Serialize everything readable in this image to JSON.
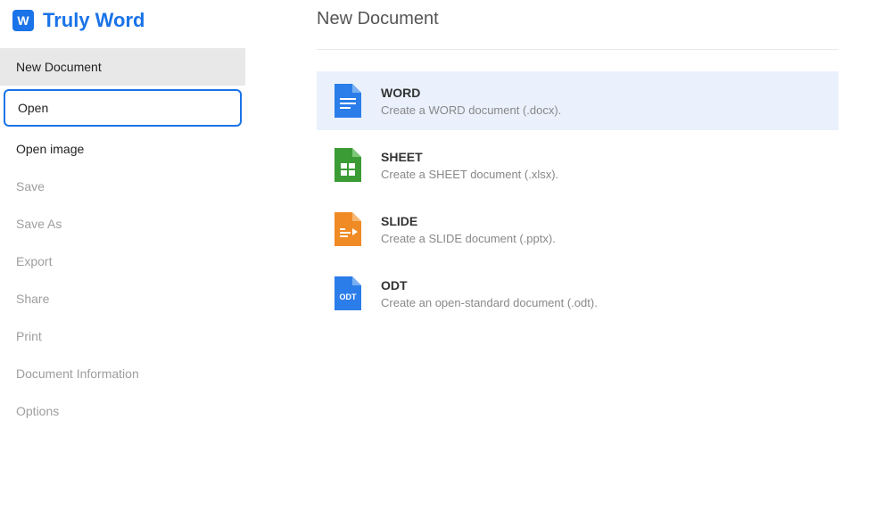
{
  "brand": {
    "title": "Truly Word",
    "icon_glyph": "W"
  },
  "sidebar": {
    "items": [
      {
        "label": "New Document",
        "state": "active"
      },
      {
        "label": "Open",
        "state": "highlighted"
      },
      {
        "label": "Open image",
        "state": "enabled"
      },
      {
        "label": "Save",
        "state": "disabled"
      },
      {
        "label": "Save As",
        "state": "disabled"
      },
      {
        "label": "Export",
        "state": "disabled"
      },
      {
        "label": "Share",
        "state": "disabled"
      },
      {
        "label": "Print",
        "state": "disabled"
      },
      {
        "label": "Document Information",
        "state": "disabled"
      },
      {
        "label": "Options",
        "state": "disabled"
      }
    ]
  },
  "main": {
    "title": "New Document",
    "options": [
      {
        "kind": "word",
        "title": "WORD",
        "desc": "Create a WORD document (.docx).",
        "selected": true,
        "icon_color": "#2b7de9"
      },
      {
        "kind": "sheet",
        "title": "SHEET",
        "desc": "Create a SHEET document (.xlsx).",
        "selected": false,
        "icon_color": "#3b9b35"
      },
      {
        "kind": "slide",
        "title": "SLIDE",
        "desc": "Create a SLIDE document (.pptx).",
        "selected": false,
        "icon_color": "#f08a24"
      },
      {
        "kind": "odt",
        "title": "ODT",
        "desc": "Create an open-standard document (.odt).",
        "selected": false,
        "icon_color": "#2b7de9"
      }
    ]
  }
}
